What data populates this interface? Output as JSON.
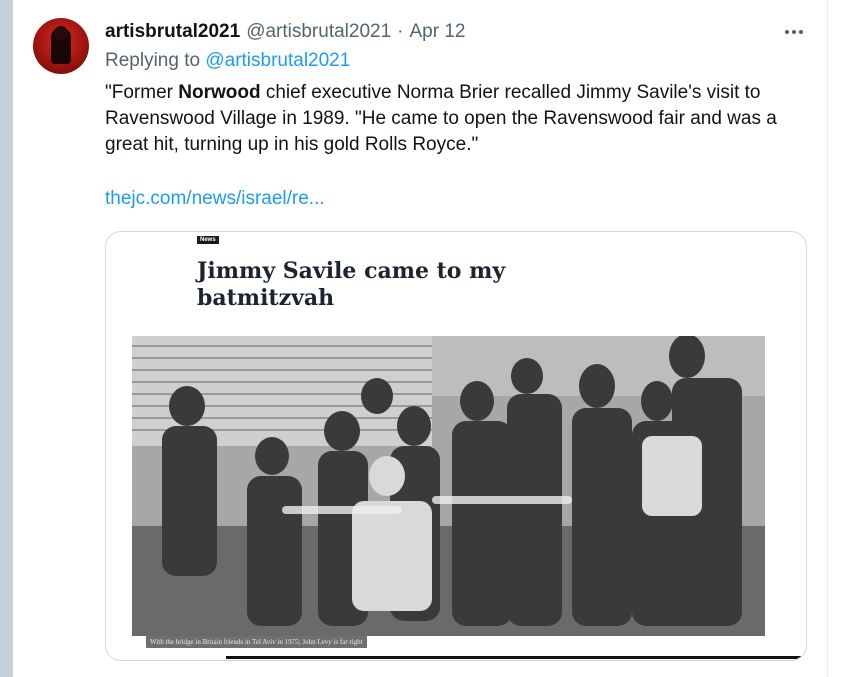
{
  "tweet": {
    "display_name": "artisbrutal2021",
    "handle": "@artisbrutal2021",
    "separator": "·",
    "date": "Apr 12",
    "replying_prefix": "Replying to",
    "replying_handle": "@artisbrutal2021",
    "text_part1": "\"Former ",
    "text_bold": "Norwood",
    "text_part2": " chief executive Norma Brier recalled Jimmy Savile's visit to Ravenswood Village in 1989. \"He came to open the Ravenswood fair and was a great hit, turning up in his gold Rolls Royce.\"",
    "link": "thejc.com/news/israel/re..."
  },
  "card": {
    "tag": "News",
    "headline": "Jimmy Savile came to my batmitzvah",
    "caption": "With the bridge in Britain friends in Tel Aviv in 1975; John Levy is far right"
  },
  "colors": {
    "accent": "#1d9bf0",
    "text_primary": "#0f1419",
    "text_secondary": "#536471",
    "border": "#cfd9de"
  },
  "icons": {
    "more": "more-horizontal-icon"
  }
}
